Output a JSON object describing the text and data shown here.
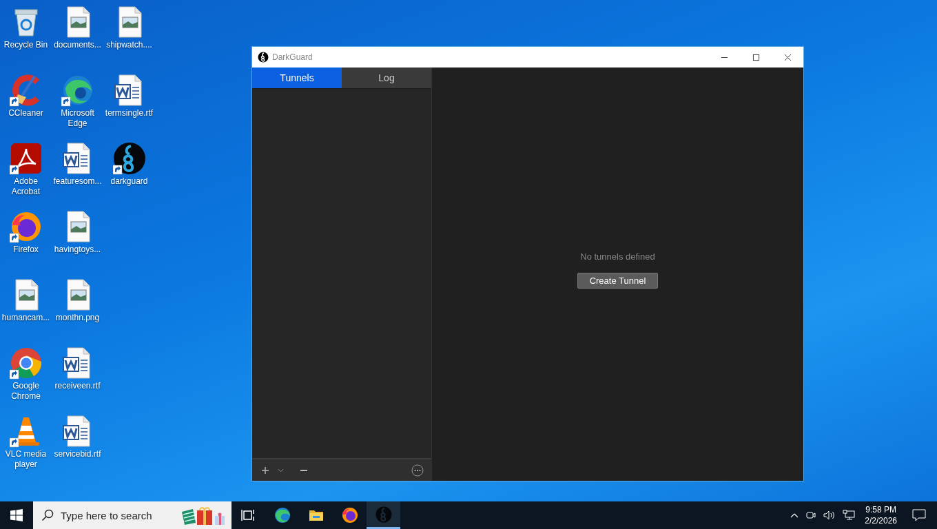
{
  "desktop": {
    "icons": [
      {
        "label": "Recycle Bin",
        "kind": "recycle",
        "shortcut": false
      },
      {
        "label": "CCleaner",
        "kind": "ccleaner",
        "shortcut": true
      },
      {
        "label": "Adobe Acrobat",
        "kind": "acrobat",
        "shortcut": true
      },
      {
        "label": "Firefox",
        "kind": "firefox",
        "shortcut": true
      },
      {
        "label": "humancam...",
        "kind": "image",
        "shortcut": false
      },
      {
        "label": "Google Chrome",
        "kind": "chrome",
        "shortcut": true
      },
      {
        "label": "VLC media player",
        "kind": "vlc",
        "shortcut": true
      },
      {
        "label": "documents...",
        "kind": "image",
        "shortcut": false
      },
      {
        "label": "Microsoft Edge",
        "kind": "edge",
        "shortcut": true
      },
      {
        "label": "featuresom...",
        "kind": "word",
        "shortcut": false
      },
      {
        "label": "havingtoys...",
        "kind": "image",
        "shortcut": false
      },
      {
        "label": "monthn.png",
        "kind": "image",
        "shortcut": false
      },
      {
        "label": "receiveen.rtf",
        "kind": "word",
        "shortcut": false
      },
      {
        "label": "servicebid.rtf",
        "kind": "word",
        "shortcut": false
      },
      {
        "label": "shipwatch....",
        "kind": "image",
        "shortcut": false
      },
      {
        "label": "termsingle.rtf",
        "kind": "word",
        "shortcut": false
      },
      {
        "label": "darkguard",
        "kind": "darkguard",
        "shortcut": true
      }
    ]
  },
  "window": {
    "title": "DarkGuard",
    "tabs": [
      {
        "label": "Tunnels",
        "selected": true
      },
      {
        "label": "Log",
        "selected": false
      }
    ],
    "empty_message": "No tunnels defined",
    "create_button": "Create Tunnel"
  },
  "taskbar": {
    "search_placeholder": "Type here to search",
    "apps": [
      {
        "kind": "taskview",
        "active": false
      },
      {
        "kind": "edge",
        "active": false
      },
      {
        "kind": "explorer",
        "active": false
      },
      {
        "kind": "firefox",
        "active": false
      },
      {
        "kind": "darkguard",
        "active": true
      }
    ],
    "clock": {
      "time": "9:58 PM",
      "date": "2/2/2026"
    }
  }
}
